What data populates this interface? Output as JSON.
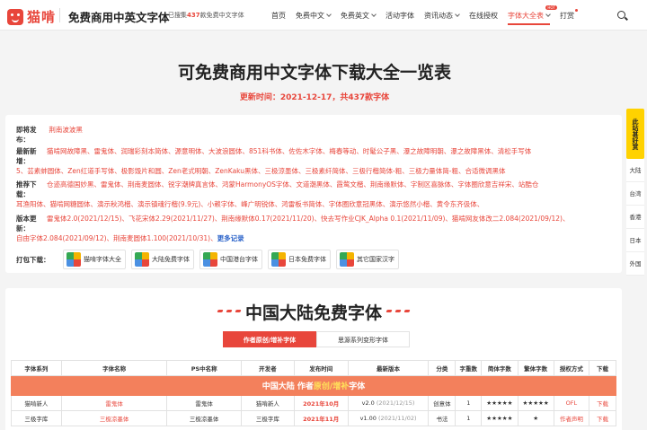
{
  "header": {
    "logo_text": "猫啃",
    "slogan": "免费商用中英文字体",
    "count_prefix": "已搜集",
    "count_value": "437",
    "count_suffix": "款免费中文字体",
    "nav": [
      {
        "label": "首页"
      },
      {
        "label": "免费中文"
      },
      {
        "label": "免费英文"
      },
      {
        "label": "活动字体"
      },
      {
        "label": "资讯动态"
      },
      {
        "label": "在线授权"
      },
      {
        "label": "字体大全表",
        "badge": "HOT"
      },
      {
        "label": "打赏"
      }
    ]
  },
  "hero": {
    "title": "可免费商用中文字体下载大全一览表",
    "updated": "更新时间：2021-12-17，共437款字体"
  },
  "info": {
    "upcoming_label": "即将发布：",
    "upcoming": "荆南波波黑",
    "recent_label": "最新新增：",
    "recent_line1": "猫啃网故障黑、雷鬼体、润瑞彩刻本简体、源意明体、大波浪圆体、851科书体、佐佐木字体、梅春等动、时髦公子黑、瀑之故障明朝、瀑之故障黑体、清松手写体",
    "recent_line2": "5、芸素蚌圆体、Zen红道手写体、极影毁片和圆、Zen老式明朝、ZenKaku黑体、三极涼墨体、三极素纤简体、三极行楷简体-粗、三极力量体简-粗、合适微调黑体",
    "recommend_label": "推荐下载：",
    "recommend_line1": "仓迹高德国妙黑、雷鬼体、荆南麦圆体、锐字潮牌真言体、鸿蒙HarmonyOS字体、文道潮黑体、霞鹜文楷、荆南缘默体、字制区喜脉体、字体圈欣意吉祥宋、站酷仓",
    "recommend_line2": "耳渔阳体、猫啃网糖圆体、演示秋鸿楷、演示镇魂行楷(9.9元)、小赖字体、峰广明锐体、鸿雷板书简体、字体圈欣意冠黑体、演示悠然小楷、黄令东齐伋体、",
    "version_label": "版本更新：",
    "version_line1": "雷鬼体2.0(2021/12/15)、飞花宋体2.29(2021/11/27)、荆南缘默体0.17(2021/11/20)、快去写作业CJK_Alpha 0.1(2021/11/09)、猫啃网友体改二2.084(2021/09/12)、",
    "version_line2a": "自由字体2.084(2021/09/12)、荆南麦圆体1.100(2021/10/31)、",
    "more": "更多记录",
    "download_label": "打包下载：",
    "packs": [
      "猫啃字体大全",
      "大陆免费字体",
      "中国港台字体",
      "日本免费字体",
      "其它国家汉字"
    ]
  },
  "section": {
    "title": "中国大陆免费字体",
    "tabs": [
      "作者原创/增补字体",
      "思源系列变形字体"
    ],
    "columns": [
      "字体系列",
      "字体名称",
      "PS中名称",
      "开发者",
      "发布时间",
      "最新版本",
      "分类",
      "字重数",
      "简体字数",
      "繁体字数",
      "授权方式",
      "下载"
    ],
    "group_prefix": "中国大陆 作者",
    "group_highlight": "原创/增补",
    "group_suffix": "字体",
    "rows": [
      {
        "series": "猫啃新人",
        "name": "雷鬼体",
        "ps": "雷鬼体",
        "dev": "猫啃新人",
        "date": "2021年10月",
        "ver": "v2.0",
        "ver_date": "(2021/12/15)",
        "cat": "创意体",
        "weights": "1",
        "simp": "★★★★★",
        "trad": "★★★★★",
        "license": "OFL",
        "dl": "下载"
      },
      {
        "series": "三极字库",
        "name": "三极凉墨体",
        "ps": "三极凉墨体",
        "dev": "三极字库",
        "date": "2021年11月",
        "ver": "v1.00",
        "ver_date": "(2021/11/02)",
        "cat": "书法",
        "weights": "1",
        "simp": "★★★★★",
        "trad": "★",
        "license": "作者声明",
        "dl": "下载"
      }
    ]
  },
  "float": {
    "hot": "此站甚好赏",
    "items": [
      "大陆",
      "台湾",
      "香港",
      "日本",
      "外国"
    ]
  }
}
